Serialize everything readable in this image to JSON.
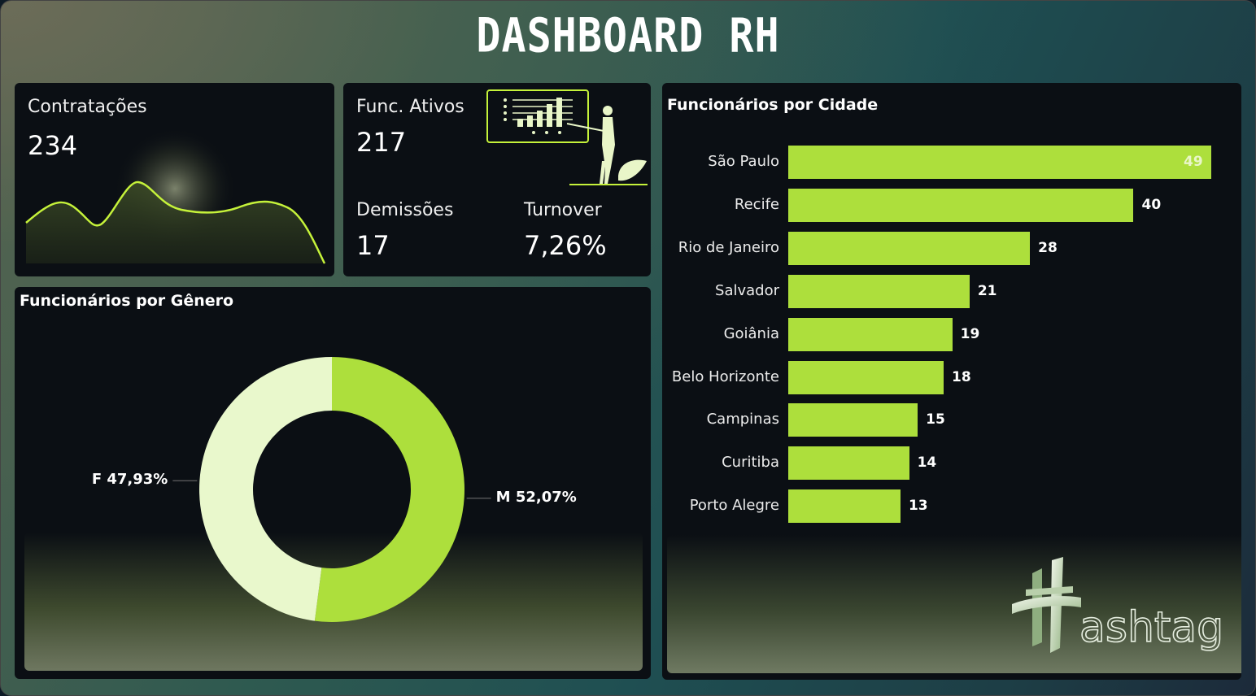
{
  "header": {
    "title": "DASHBOARD RH"
  },
  "colors": {
    "accent": "#addf3c",
    "accent_light": "#e9f8cc",
    "card": "#0b0f14"
  },
  "kpis": {
    "contratacoes": {
      "label": "Contratações",
      "value": "234"
    },
    "func_ativos": {
      "label": "Func. Ativos",
      "value": "217"
    },
    "demissoes": {
      "label": "Demissões",
      "value": "17"
    },
    "turnover": {
      "label": "Turnover",
      "value": "7,26%"
    }
  },
  "chart_data": [
    {
      "type": "bar",
      "orientation": "horizontal",
      "title": "Funcionários por Cidade",
      "categories": [
        "São Paulo",
        "Recife",
        "Rio de Janeiro",
        "Salvador",
        "Goiânia",
        "Belo Horizonte",
        "Campinas",
        "Curitiba",
        "Porto Alegre"
      ],
      "values": [
        49,
        40,
        28,
        21,
        19,
        18,
        15,
        14,
        13
      ],
      "xlim": [
        0,
        49
      ]
    },
    {
      "type": "pie",
      "variant": "donut",
      "title": "Funcionários por Gênero",
      "slices": [
        {
          "label": "M",
          "percent": 52.07,
          "display": "M 52,07%",
          "color": "#addf3c"
        },
        {
          "label": "F",
          "percent": 47.93,
          "display": "F 47,93%",
          "color": "#e9f8cc"
        }
      ]
    }
  ]
}
